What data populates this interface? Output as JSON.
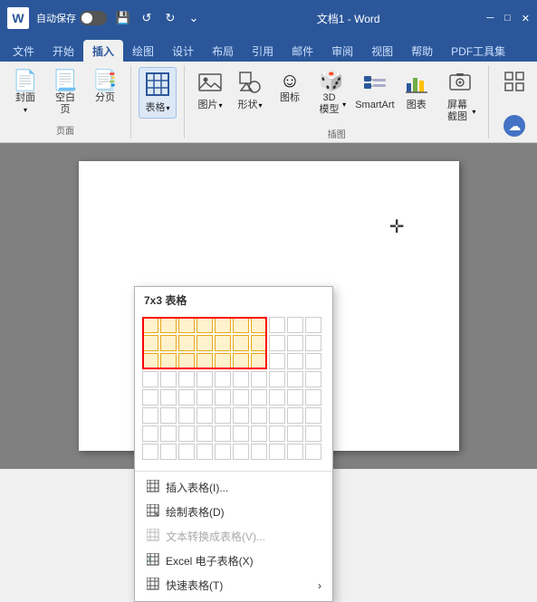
{
  "titlebar": {
    "word_icon": "W",
    "autosave_label": "自动保存",
    "toggle_state": "off",
    "title": "文档1 - Word",
    "undo_icon": "↺",
    "redo_icon": "↻",
    "more_icon": "⌄"
  },
  "ribbon": {
    "tabs": [
      {
        "id": "file",
        "label": "文件",
        "active": false
      },
      {
        "id": "home",
        "label": "开始",
        "active": false
      },
      {
        "id": "insert",
        "label": "插入",
        "active": true
      },
      {
        "id": "draw",
        "label": "绘图",
        "active": false
      },
      {
        "id": "design",
        "label": "设计",
        "active": false
      },
      {
        "id": "layout",
        "label": "布局",
        "active": false
      },
      {
        "id": "references",
        "label": "引用",
        "active": false
      },
      {
        "id": "mailings",
        "label": "邮件",
        "active": false
      },
      {
        "id": "review",
        "label": "审阅",
        "active": false
      },
      {
        "id": "view",
        "label": "视图",
        "active": false
      },
      {
        "id": "help",
        "label": "帮助",
        "active": false
      },
      {
        "id": "pdf",
        "label": "PDF工具集",
        "active": false
      }
    ],
    "groups": [
      {
        "id": "pages",
        "label": "页面",
        "buttons": [
          {
            "id": "cover",
            "label": "封面",
            "icon": "📄"
          },
          {
            "id": "blank",
            "label": "空白页",
            "icon": "📃"
          },
          {
            "id": "break",
            "label": "分页",
            "icon": "📑"
          }
        ]
      },
      {
        "id": "table",
        "label": "",
        "buttons": [
          {
            "id": "table",
            "label": "表格",
            "icon": "⊞",
            "active": true
          }
        ]
      },
      {
        "id": "illustrations",
        "label": "插图",
        "buttons": [
          {
            "id": "pictures",
            "label": "图片",
            "icon": "🖼"
          },
          {
            "id": "shapes",
            "label": "形状",
            "icon": "⬡"
          },
          {
            "id": "icons",
            "label": "图标",
            "icon": "☺"
          },
          {
            "id": "3dmodel",
            "label": "3D 模\n型",
            "icon": "🎲"
          },
          {
            "id": "smartart",
            "label": "SmartArt",
            "icon": "📊"
          },
          {
            "id": "chart",
            "label": "图表",
            "icon": "📈"
          },
          {
            "id": "screenshot",
            "label": "屏幕截图",
            "icon": "📷"
          }
        ]
      },
      {
        "id": "extra",
        "label": "",
        "buttons": [
          {
            "id": "extra1",
            "label": "",
            "icon": "⊞"
          }
        ]
      }
    ]
  },
  "table_dropdown": {
    "title": "7x3 表格",
    "grid": {
      "cols": 10,
      "rows": 8,
      "highlight_cols": 7,
      "highlight_rows": 3
    },
    "menu_items": [
      {
        "id": "insert_table",
        "label": "插入表格(I)...",
        "icon": "⊞",
        "disabled": false,
        "has_arrow": false
      },
      {
        "id": "draw_table",
        "label": "绘制表格(D)",
        "icon": "✏",
        "disabled": false,
        "has_arrow": false
      },
      {
        "id": "text_to_table",
        "label": "文本转换成表格(V)...",
        "icon": "⊟",
        "disabled": true,
        "has_arrow": false
      },
      {
        "id": "excel_table",
        "label": "Excel 电子表格(X)",
        "icon": "⊞",
        "disabled": false,
        "has_arrow": false
      },
      {
        "id": "quick_table",
        "label": "快速表格(T)",
        "icon": "⊞",
        "disabled": false,
        "has_arrow": true
      }
    ]
  },
  "document": {
    "background_color": "#808080",
    "page_color": "#ffffff"
  }
}
